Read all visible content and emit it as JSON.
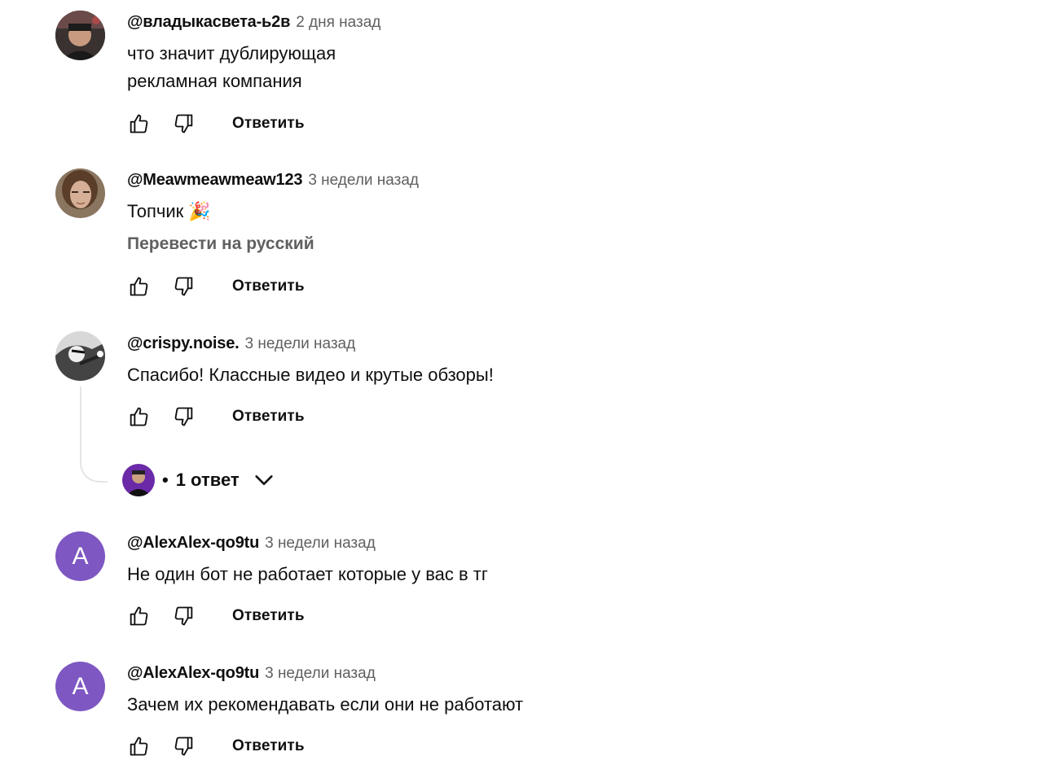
{
  "comments": [
    {
      "author": "@владыкасвета-ь2в",
      "time": "2 дня назад",
      "text_lines": [
        "что значит дублирующая",
        "рекламная компания"
      ],
      "reply_label": "Ответить"
    },
    {
      "author": "@Meawmeawmeaw123",
      "time": "3 недели назад",
      "text": "Топчик 🎉",
      "translate_label": "Перевести на русский",
      "reply_label": "Ответить"
    },
    {
      "author": "@crispy.noise.",
      "time": "3 недели назад",
      "text": "Спасибо! Классные видео и крутые обзоры!",
      "reply_label": "Ответить",
      "replies": {
        "dot": "•",
        "count_label": "1 ответ"
      }
    },
    {
      "author": "@AlexAlex-qo9tu",
      "time": "3 недели назад",
      "avatar_letter": "A",
      "avatar_color": "#7e57c2",
      "text": "Не один бот не работает которые у вас  в тг",
      "reply_label": "Ответить"
    },
    {
      "author": "@AlexAlex-qo9tu",
      "time": "3 недели назад",
      "avatar_letter": "A",
      "avatar_color": "#7e57c2",
      "text": "Зачем их рекомендавать если они не работают",
      "reply_label": "Ответить"
    }
  ],
  "icons": {
    "like": "thumbs-up-icon",
    "dislike": "thumbs-down-icon",
    "expand": "chevron-down-icon"
  }
}
